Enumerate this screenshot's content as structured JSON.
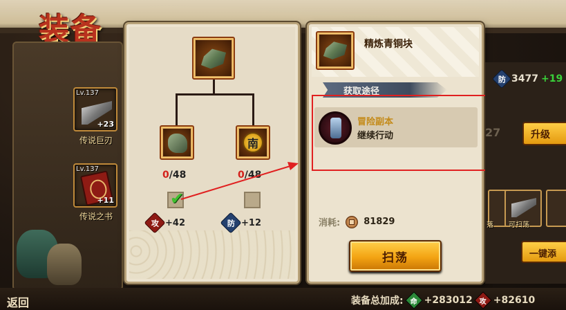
{
  "screen_title": "装备",
  "sidebar": {
    "items": [
      {
        "level": "Lv.137",
        "plus": "+23",
        "name": "传说巨刃"
      },
      {
        "level": "Lv.137",
        "plus": "+11",
        "name": "传说之书"
      }
    ]
  },
  "synthesis": {
    "target_icon": "refined-bronze-block-icon",
    "materials": [
      {
        "icon": "bronze-ore-icon",
        "have": "0",
        "need": "/48"
      },
      {
        "icon": "south-coin-icon",
        "coin_char": "南",
        "have": "0",
        "need": "/48"
      }
    ],
    "bonuses": [
      {
        "type": "攻",
        "value": "+42"
      },
      {
        "type": "防",
        "value": "+12"
      }
    ]
  },
  "detail": {
    "item_name": "精炼青铜块",
    "source_header": "获取途径",
    "source_entry": {
      "name": "冒险副本",
      "status": "继续行动"
    },
    "cost_label": "消耗:",
    "cost_value": "81829",
    "sweep_label": "扫荡"
  },
  "background_right": {
    "defense_label": "防",
    "defense_value": "3477",
    "defense_bonus": "+19",
    "partial_number": "27",
    "upgrade_label": "升级",
    "slot_labels": [
      "落",
      "可扫荡"
    ],
    "onekey_label": "一键添"
  },
  "footer": {
    "back_label": "返回",
    "total_bonus_label": "装备总加成:",
    "life_label": "命",
    "life_value": "+283012",
    "atk_label": "攻",
    "atk_value": "+82610"
  },
  "colors": {
    "highlight_border": "#e02020",
    "count_have": "#d3211b",
    "bonus_green": "#3ad13a"
  }
}
